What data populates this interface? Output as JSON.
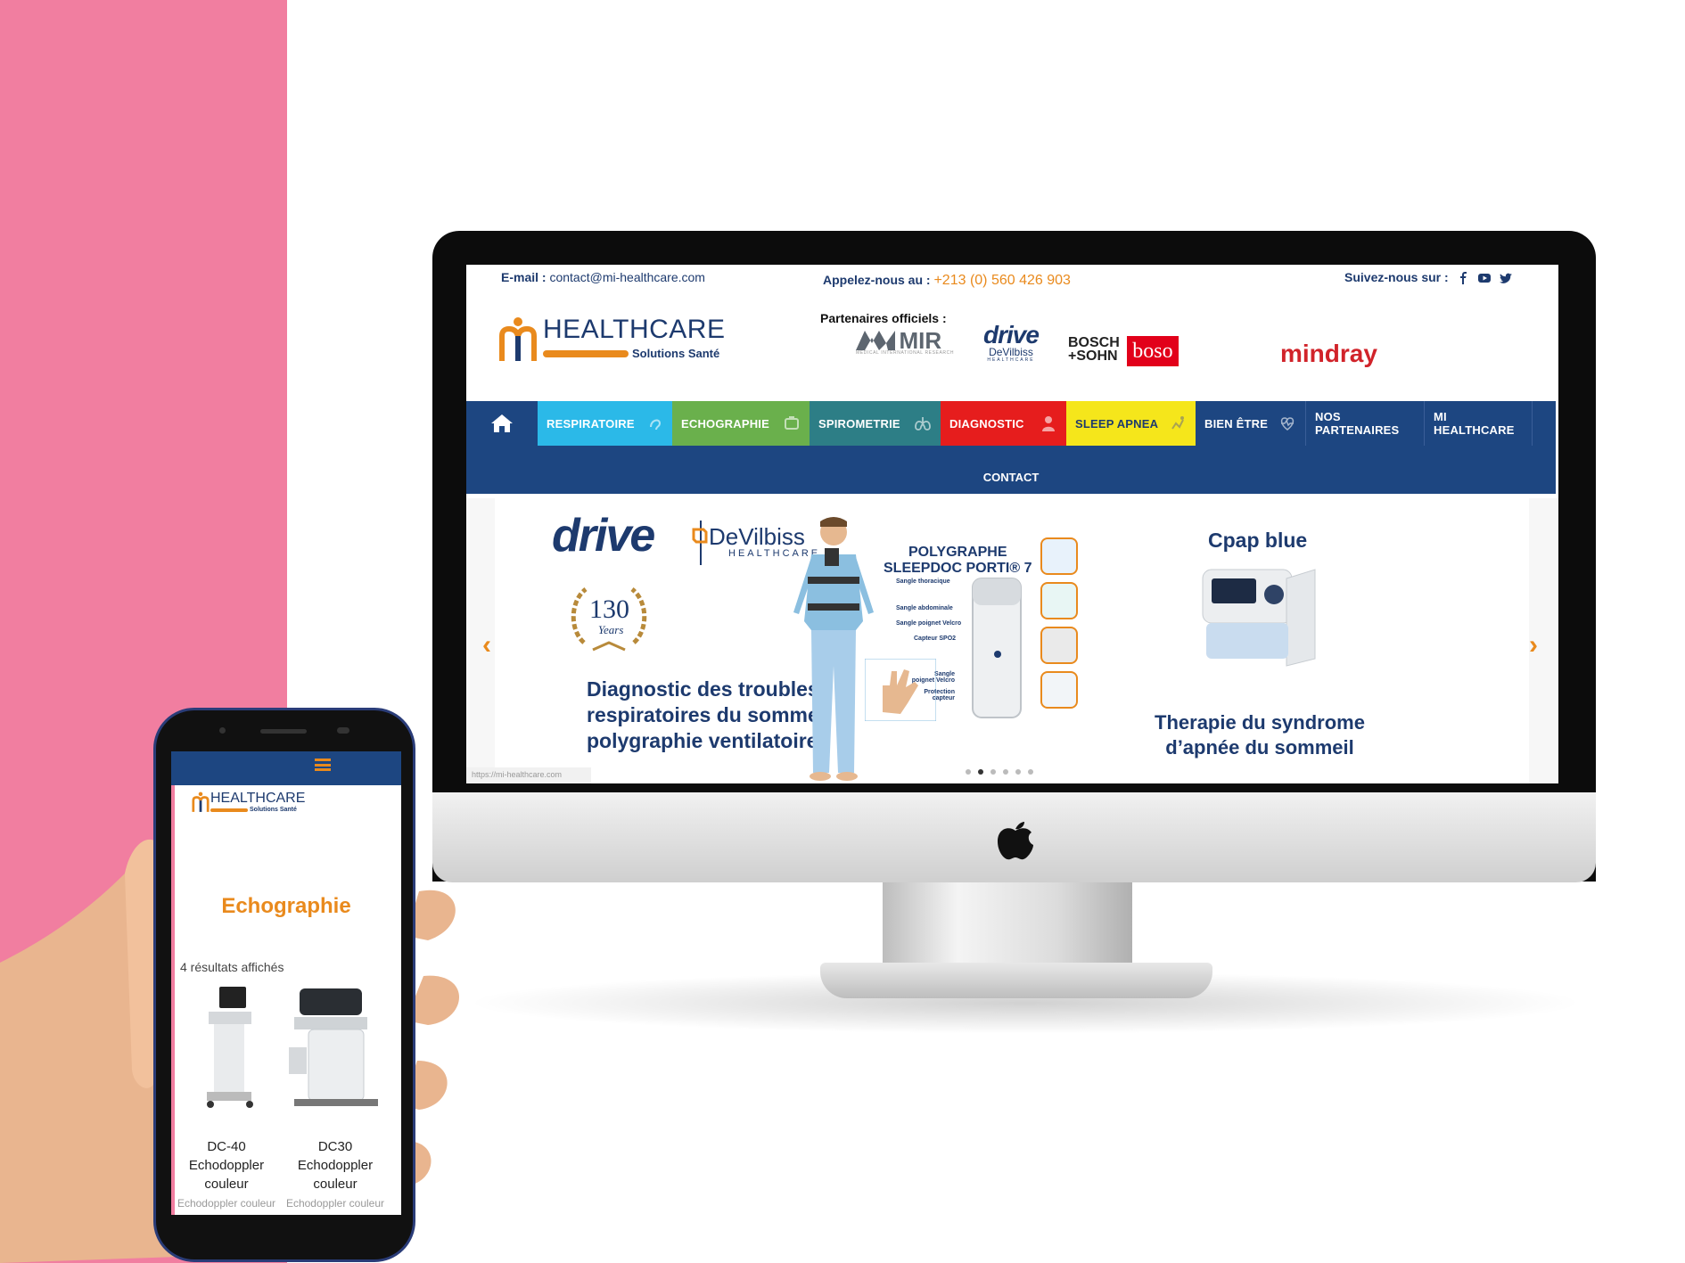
{
  "desktop": {
    "topbar": {
      "email_label": "E-mail :",
      "email_value": "contact@mi-healthcare.com",
      "phone_label": "Appelez-nous au :",
      "phone_value": "+213 (0) 560 426 903",
      "follow_label": "Suivez-nous sur :",
      "social_icons": [
        "facebook-icon",
        "youtube-icon",
        "twitter-icon"
      ]
    },
    "logo": {
      "title": "HEALTHCARE",
      "subtitle": "Solutions Santé"
    },
    "partners": {
      "label": "Partenaires officiels :",
      "items": [
        {
          "name": "MIR",
          "sub": "MEDICAL INTERNATIONAL RESEARCH"
        },
        {
          "name": "drive",
          "sub": "DeVilbiss",
          "sub2": "HEALTHCARE"
        },
        {
          "name": "BOSCH",
          "name2": "+SOHN",
          "badge": "boso"
        },
        {
          "name": "mindray"
        }
      ]
    },
    "nav": {
      "items": [
        {
          "label": "RESPIRATOIRE",
          "color": "#2bb9e8"
        },
        {
          "label": "ECHOGRAPHIE",
          "color": "#6ab04c"
        },
        {
          "label": "SPIROMETRIE",
          "color": "#2d7e86"
        },
        {
          "label": "DIAGNOSTIC",
          "color": "#e61d1d"
        },
        {
          "label": "SLEEP APNEA",
          "color": "#f5e61b"
        },
        {
          "label": "BIEN ÊTRE",
          "color": "#1d4681"
        },
        {
          "label": "NOS PARTENAIRES",
          "color": "#1d4681"
        },
        {
          "label": "MI HEALTHCARE",
          "color": "#1d4681"
        }
      ],
      "contact": "CONTACT"
    },
    "slider": {
      "brand_left": "drive",
      "brand_right": "DeVilbiss",
      "brand_right_sub": "HEALTHCARE",
      "badge_years": "130",
      "badge_text": "Years",
      "headline_lines": [
        "Diagnostic des troubles",
        "respiratoires du sommeil",
        "polygraphie ventilatoire"
      ],
      "product_title_lines": [
        "POLYGRAPHE",
        "SLEEPDOC PORTI® 7"
      ],
      "labels": [
        "Sangle thoracique",
        "Sangle abdominale",
        "Sangle poignet Velcro",
        "Capteur SPO2",
        "Sangle poignet Velcro",
        "Protection capteur"
      ],
      "cpap_title": "Cpap blue",
      "therapy_lines": [
        "Therapie du syndrome",
        "d’apnée du sommeil"
      ],
      "prev": "‹",
      "next": "›",
      "url": "https://mi-healthcare.com"
    }
  },
  "mobile": {
    "logo": {
      "title": "HEALTHCARE",
      "subtitle": "Solutions Santé"
    },
    "page_title": "Echographie",
    "results": "4 résultats affichés",
    "products": [
      {
        "name_lines": [
          "DC-40",
          "Echodoppler",
          "couleur"
        ],
        "category": "Echodoppler couleur"
      },
      {
        "name_lines": [
          "DC30",
          "Echodoppler",
          "couleur"
        ],
        "category": "Echodoppler couleur"
      }
    ]
  },
  "colors": {
    "brand_blue": "#1d4681",
    "brand_orange": "#e98a1d",
    "background_pink": "#f17ea0"
  }
}
